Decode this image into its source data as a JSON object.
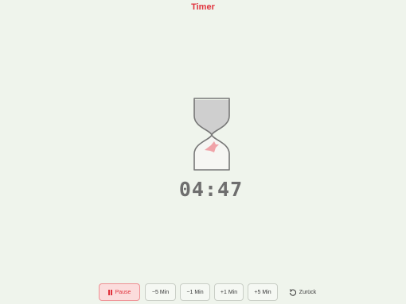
{
  "header": {
    "title": "Timer"
  },
  "timer": {
    "display": "04:47"
  },
  "controls": {
    "pause_label": "Pause",
    "minus5_label": "−5 Min",
    "minus1_label": "−1 Min",
    "plus1_label": "+1 Min",
    "plus5_label": "+5 Min",
    "back_label": "Zurück"
  },
  "colors": {
    "accent": "#e0323c",
    "background": "#eff4ec",
    "sand": "#cfcfcf",
    "bird": "#f0a3a8"
  },
  "icons": {
    "hourglass": "hourglass-icon",
    "pause": "pause-icon",
    "back": "undo-icon"
  }
}
